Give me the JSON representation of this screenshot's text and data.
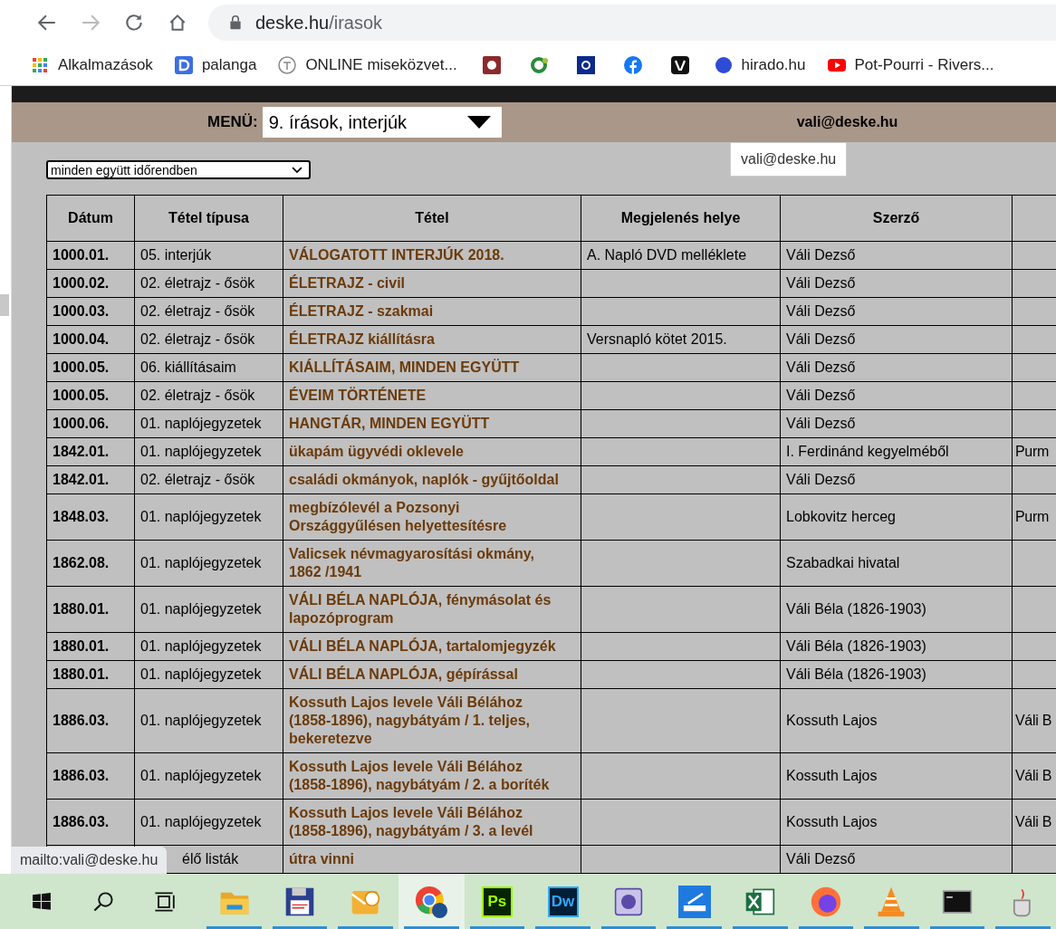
{
  "browser": {
    "address": {
      "host": "deske.hu",
      "path": "/irasok"
    },
    "bookmarks": [
      {
        "kind": "apps",
        "label": "Alkalmazások"
      },
      {
        "kind": "d-square",
        "label": "palanga"
      },
      {
        "kind": "ring",
        "label": "ONLINE miseközvet..."
      },
      {
        "kind": "red-square"
      },
      {
        "kind": "green-ring"
      },
      {
        "kind": "blue-square"
      },
      {
        "kind": "facebook"
      },
      {
        "kind": "black-square"
      },
      {
        "kind": "blue-dot",
        "label": "hirado.hu"
      },
      {
        "kind": "youtube",
        "label": "Pot-Pourri - Rivers..."
      }
    ]
  },
  "menu_bar": {
    "label": "MENÜ:",
    "selected_menu": "9. írások, interjúk",
    "email": "vali@deske.hu"
  },
  "email_tooltip": "vali@deske.hu",
  "filter": {
    "value": "minden együtt időrendben"
  },
  "table": {
    "columns": [
      "Dátum",
      "Tétel típusa",
      "Tétel",
      "Megjelenés helye",
      "Szerző"
    ],
    "rows": [
      {
        "date": "1000.01.",
        "type": "05. interjúk",
        "title": "VÁLOGATOTT INTERJÚK 2018.",
        "place": "A. Napló DVD melléklete",
        "author": "Váli Dezső"
      },
      {
        "date": "1000.02.",
        "type": "02. életrajz - ősök",
        "title": "ÉLETRAJZ - civil",
        "author": "Váli Dezső"
      },
      {
        "date": "1000.03.",
        "type": "02. életrajz - ősök",
        "title": "ÉLETRAJZ - szakmai",
        "author": "Váli Dezső"
      },
      {
        "date": "1000.04.",
        "type": "02. életrajz - ősök",
        "title": "ÉLETRAJZ kiállításra",
        "place": "Versnapló kötet 2015.",
        "author": "Váli Dezső"
      },
      {
        "date": "1000.05.",
        "type": "06. kiállításaim",
        "title": "KIÁLLÍTÁSAIM, MINDEN EGYÜTT",
        "author": "Váli Dezső"
      },
      {
        "date": "1000.05.",
        "type": "02. életrajz - ősök",
        "title": "ÉVEIM TÖRTÉNETE",
        "author": "Váli Dezső"
      },
      {
        "date": "1000.06.",
        "type": "01. naplójegyzetek",
        "title": "HANGTÁR, MINDEN EGYÜTT",
        "author": "Váli Dezső"
      },
      {
        "date": "1842.01.",
        "type": "01. naplójegyzetek",
        "title": "ükapám ügyvédi oklevele",
        "author": "I. Ferdinánd kegyelméből",
        "column_6": "Purm"
      },
      {
        "date": "1842.01.",
        "type": "02. életrajz - ősök",
        "title": "családi okmányok, naplók - gyűjtőoldal",
        "author": "Váli Dezső"
      },
      {
        "date": "1848.03.",
        "type": "01. naplójegyzetek",
        "title": "megbízólevél a Pozsonyi Országgyűlésen helyettesítésre",
        "author": "Lobkovitz herceg",
        "column_6": "Purm"
      },
      {
        "date": "1862.08.",
        "type": "01. naplójegyzetek",
        "title": "Valicsek névmagyarosítási okmány, 1862 /1941",
        "author": "Szabadkai hivatal"
      },
      {
        "date": "1880.01.",
        "type": "01. naplójegyzetek",
        "title": "VÁLI BÉLA NAPLÓJA, fénymásolat és lapozóprogram",
        "author": "Váli Béla (1826-1903)"
      },
      {
        "date": "1880.01.",
        "type": "01. naplójegyzetek",
        "title": "VÁLI BÉLA NAPLÓJA, tartalomjegyzék",
        "author": "Váli Béla (1826-1903)"
      },
      {
        "date": "1880.01.",
        "type": "01. naplójegyzetek",
        "title": "VÁLI BÉLA NAPLÓJA, gépírással",
        "author": "Váli Béla (1826-1903)"
      },
      {
        "date": "1886.03.",
        "type": "01. naplójegyzetek",
        "title": "Kossuth Lajos levele Váli Bélához (1858-1896), nagybátyám / 1. teljes, bekeretezve",
        "author": "Kossuth Lajos",
        "column_6": "Váli B"
      },
      {
        "date": "1886.03.",
        "type": "01. naplójegyzetek",
        "title": "Kossuth Lajos levele Váli Bélához (1858-1896), nagybátyám / 2. a boríték",
        "author": "Kossuth Lajos",
        "column_6": "Váli B"
      },
      {
        "date": "1886.03.",
        "type": "01. naplójegyzetek",
        "title": "Kossuth Lajos levele Váli Bélához (1858-1896), nagybátyám / 3. a levél",
        "author": "Kossuth Lajos",
        "column_6": "Váli B"
      },
      {
        "covered": true,
        "type": "élő listák",
        "title": "útra vinni",
        "author": "Váli Dezső"
      }
    ]
  },
  "status_tooltip": "mailto:vali@deske.hu",
  "taskbar": [
    {
      "kind": "windows",
      "running": false,
      "selected": false
    },
    {
      "kind": "search",
      "running": false,
      "selected": false
    },
    {
      "kind": "task-view",
      "running": false,
      "selected": false
    },
    {
      "kind": "folder",
      "running": true,
      "selected": false
    },
    {
      "kind": "floppy",
      "running": true,
      "selected": false
    },
    {
      "kind": "mail-clock",
      "running": true,
      "selected": false
    },
    {
      "kind": "chrome",
      "running": true,
      "selected": true
    },
    {
      "kind": "letters",
      "label": "Ps",
      "running": true,
      "selected": false
    },
    {
      "kind": "letters",
      "label": "Dw",
      "running": true,
      "selected": false
    },
    {
      "kind": "purple-app",
      "running": true,
      "selected": false
    },
    {
      "kind": "scanner",
      "running": true,
      "selected": false
    },
    {
      "kind": "excel",
      "running": true,
      "selected": false
    },
    {
      "kind": "firefox",
      "running": true,
      "selected": false
    },
    {
      "kind": "cone",
      "running": true,
      "selected": false
    },
    {
      "kind": "terminal",
      "running": true,
      "selected": false
    },
    {
      "kind": "cup",
      "running": true,
      "selected": false
    }
  ]
}
